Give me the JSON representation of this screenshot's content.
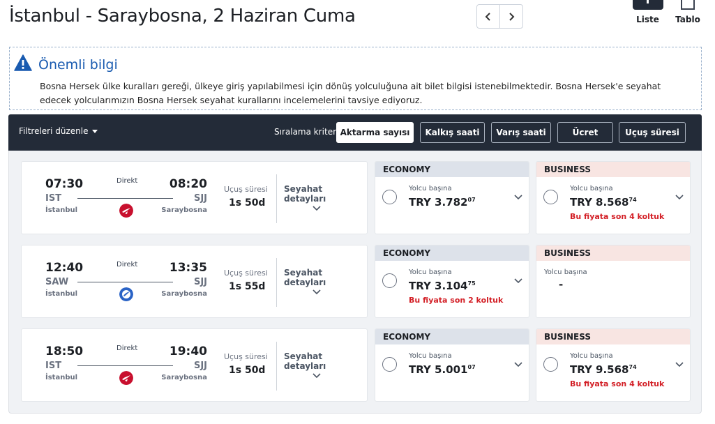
{
  "header": {
    "title": "İstanbul - Saraybosna, 2 Haziran Cuma",
    "prev_icon": "chevron-left-icon",
    "next_icon": "chevron-right-icon",
    "view_list_label": "Liste",
    "view_table_label": "Tablo"
  },
  "info": {
    "title": "Önemli bilgi",
    "text": "Bosna Hersek ülke kuralları gereği, ülkeye giriş yapılabilmesi için dönüş yolculuğuna ait bilet bilgisi istenebilmektedir. Bosna Hersek'e seyahat edecek yolcularımızın Bosna Hersek seyahat kurallarını incelemelerini tavsiye ediyoruz."
  },
  "filters": {
    "edit_label": "Filtreleri düzenle",
    "sort_label": "Sıralama kriteri",
    "sort_options": [
      "Aktarma sayısı",
      "Kalkış saati",
      "Varış saati",
      "Ücret",
      "Uçuş süresi"
    ],
    "active_sort": "Aktarma sayısı"
  },
  "common": {
    "direct": "Direkt",
    "duration_label": "Uçuş süresi",
    "details_label": "Seyahat detayları",
    "per_passenger": "Yolcu başına",
    "economy": "ECONOMY",
    "business": "BUSINESS"
  },
  "flights": [
    {
      "dep_time": "07:30",
      "dep_code": "IST",
      "dep_city": "İstanbul",
      "arr_time": "08:20",
      "arr_code": "SJJ",
      "arr_city": "Saraybosna",
      "airline_logo": "turkish-airlines-logo",
      "duration": "1s 50d",
      "economy": {
        "price_main": "TRY 3.782",
        "price_cents": "07",
        "warning": ""
      },
      "business": {
        "price_main": "TRY 8.568",
        "price_cents": "74",
        "warning": "Bu fiyata son 4 koltuk"
      }
    },
    {
      "dep_time": "12:40",
      "dep_code": "SAW",
      "dep_city": "İstanbul",
      "arr_time": "13:35",
      "arr_code": "SJJ",
      "arr_city": "Saraybosna",
      "airline_logo": "anadolujet-logo",
      "duration": "1s 55d",
      "economy": {
        "price_main": "TRY 3.104",
        "price_cents": "75",
        "warning": "Bu fiyata son 2 koltuk"
      },
      "business": {
        "unavailable": "-"
      }
    },
    {
      "dep_time": "18:50",
      "dep_code": "IST",
      "dep_city": "İstanbul",
      "arr_time": "19:40",
      "arr_code": "SJJ",
      "arr_city": "Saraybosna",
      "airline_logo": "turkish-airlines-logo",
      "duration": "1s 50d",
      "economy": {
        "price_main": "TRY 5.001",
        "price_cents": "07",
        "warning": ""
      },
      "business": {
        "price_main": "TRY 9.568",
        "price_cents": "74",
        "warning": "Bu fiyata son 4 koltuk"
      }
    }
  ],
  "colors": {
    "dark_bar": "#232b38",
    "accent_blue": "#1a5bb0",
    "warning_red": "#d31f26",
    "economy_header": "#dde2ea",
    "business_header": "#f8e5e2"
  }
}
